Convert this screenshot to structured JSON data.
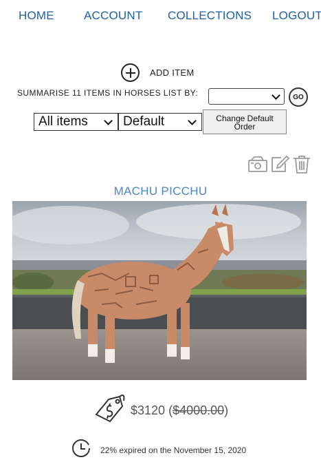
{
  "nav": {
    "home": "HOME",
    "account": "ACCOUNT",
    "collections": "COLLECTIONS",
    "logout": "LOGOUT"
  },
  "toolbar": {
    "add_item_label": "ADD ITEM",
    "summarise_label": "SUMMARISE 11 ITEMS IN HORSES LIST BY:",
    "summarise_select_value": "",
    "go_label": "GO",
    "filter_select_value": "All items",
    "order_select_value": "Default",
    "change_order_label_line1": "Change Default",
    "change_order_label_line2": "Order"
  },
  "item_actions": {
    "icons": [
      "cash-icon",
      "edit-icon",
      "trash-icon"
    ]
  },
  "item": {
    "title": "MACHU PICCHU",
    "price": "$3120",
    "price_open": "(",
    "original_price": "$4000.00",
    "price_close": ")",
    "expiry_text": "22% expired on the November 15, 2020",
    "icons": [
      "price-tag-icon",
      "clock-icon"
    ]
  },
  "colors": {
    "nav_link": "#1d5fa8",
    "title": "#4a86c8"
  }
}
